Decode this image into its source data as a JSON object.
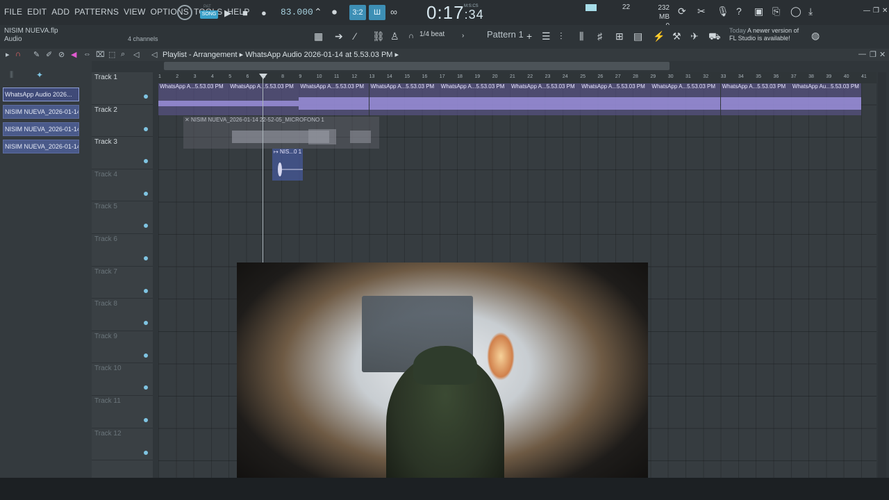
{
  "menu": [
    "FILE",
    "EDIT",
    "ADD",
    "PATTERNS",
    "VIEW",
    "OPTIONS",
    "TOOLS",
    "HELP"
  ],
  "transport": {
    "pat_label": "PAT",
    "song_label": "SONG",
    "bpm": "83.000",
    "time_main": "0:17",
    "time_frac": ":34",
    "time_unit": "M:S:CS",
    "cpu_value": "22",
    "mem_mb": "232 MB",
    "mem_val": "0"
  },
  "project": {
    "filename": "NISIM NUEVA.flp",
    "subtitle": "Audio",
    "channels": "4 channels",
    "snap": "1/4 beat",
    "pattern": "Pattern 1",
    "news_date": "Today",
    "news_line1": "A newer version of",
    "news_line2": "FL Studio is available!"
  },
  "playlist": {
    "title": "Playlist - Arrangement",
    "breadcrumb": "WhatsApp Audio 2026-01-14 at 5.53.03 PM"
  },
  "browser_clips": [
    "WhatsApp Audio 2026...",
    "NISIM NUEVA_2026-01-14...",
    "NISIM NUEVA_2026-01-14...",
    "NISIM NUEVA_2026-01-14..."
  ],
  "tracks": [
    "Track 1",
    "Track 2",
    "Track 3",
    "Track 4",
    "Track 5",
    "Track 6",
    "Track 7",
    "Track 8",
    "Track 9",
    "Track 10",
    "Track 11",
    "Track 12"
  ],
  "ruler": [
    "1",
    "2",
    "3",
    "4",
    "5",
    "6",
    "7",
    "8",
    "9",
    "10",
    "11",
    "12",
    "13",
    "14",
    "15",
    "16",
    "17",
    "18",
    "19",
    "20",
    "21",
    "22",
    "23",
    "24",
    "25",
    "26",
    "27",
    "28",
    "29",
    "30",
    "31",
    "32",
    "33",
    "34",
    "35",
    "36",
    "37",
    "38",
    "39",
    "40",
    "41"
  ],
  "clips": {
    "track1_label": "WhatsApp A...5.53.03 PM",
    "track1_last_label": "WhatsApp Au...5.53.03 PM",
    "track2_label": "NISIM NUEVA_2026-01-14 22-52-05_MICROFONO 1",
    "track3_label": "NIS...0 1"
  },
  "colors": {
    "accent": "#3d8fb5",
    "clip_audio": "#605896",
    "background": "#30363a"
  }
}
